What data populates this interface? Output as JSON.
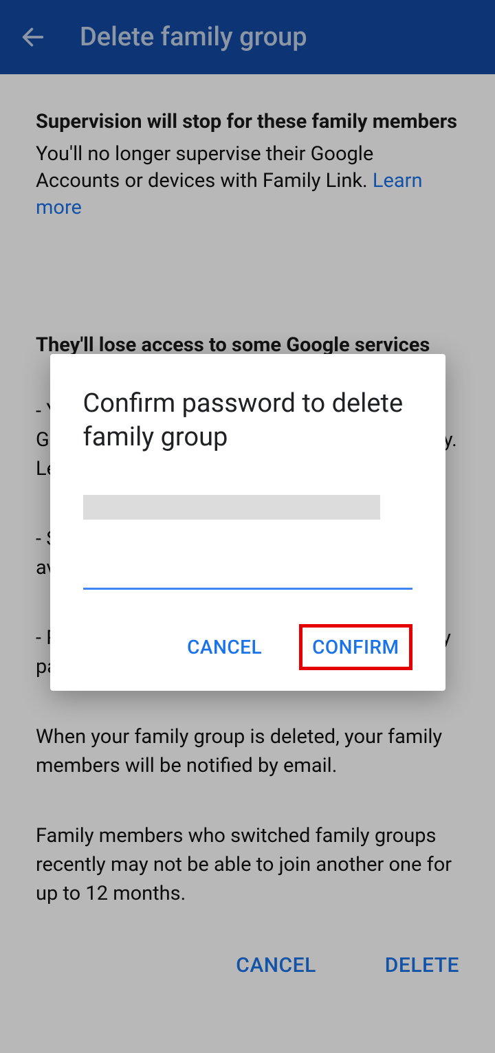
{
  "header": {
    "title": "Delete family group"
  },
  "sections": {
    "supervision_heading": "Supervision will stop for these family members",
    "supervision_text": "You'll no longer supervise their Google Accounts or devices with Family Link. ",
    "learn_more": "Learn more",
    "lose_access_heading": "They'll lose access to some Google services",
    "bullet1": "- Your family members will lose access to Google services that you share with your family. Learn more",
    "bullet2": "- Shared YouTube TV memberships won't be available.",
    "bullet3": "- Purchases made using the Google Play family payment method won't be possible.",
    "when_deleted": "When your family group is deleted, your family members will be notified by email.",
    "switch_note": "Family members who switched family groups recently may not be able to join another one for up to 12 months."
  },
  "footer": {
    "cancel": "CANCEL",
    "delete": "DELETE"
  },
  "dialog": {
    "title": "Confirm password to delete family group",
    "password_value": "",
    "cancel": "CANCEL",
    "confirm": "CONFIRM"
  }
}
